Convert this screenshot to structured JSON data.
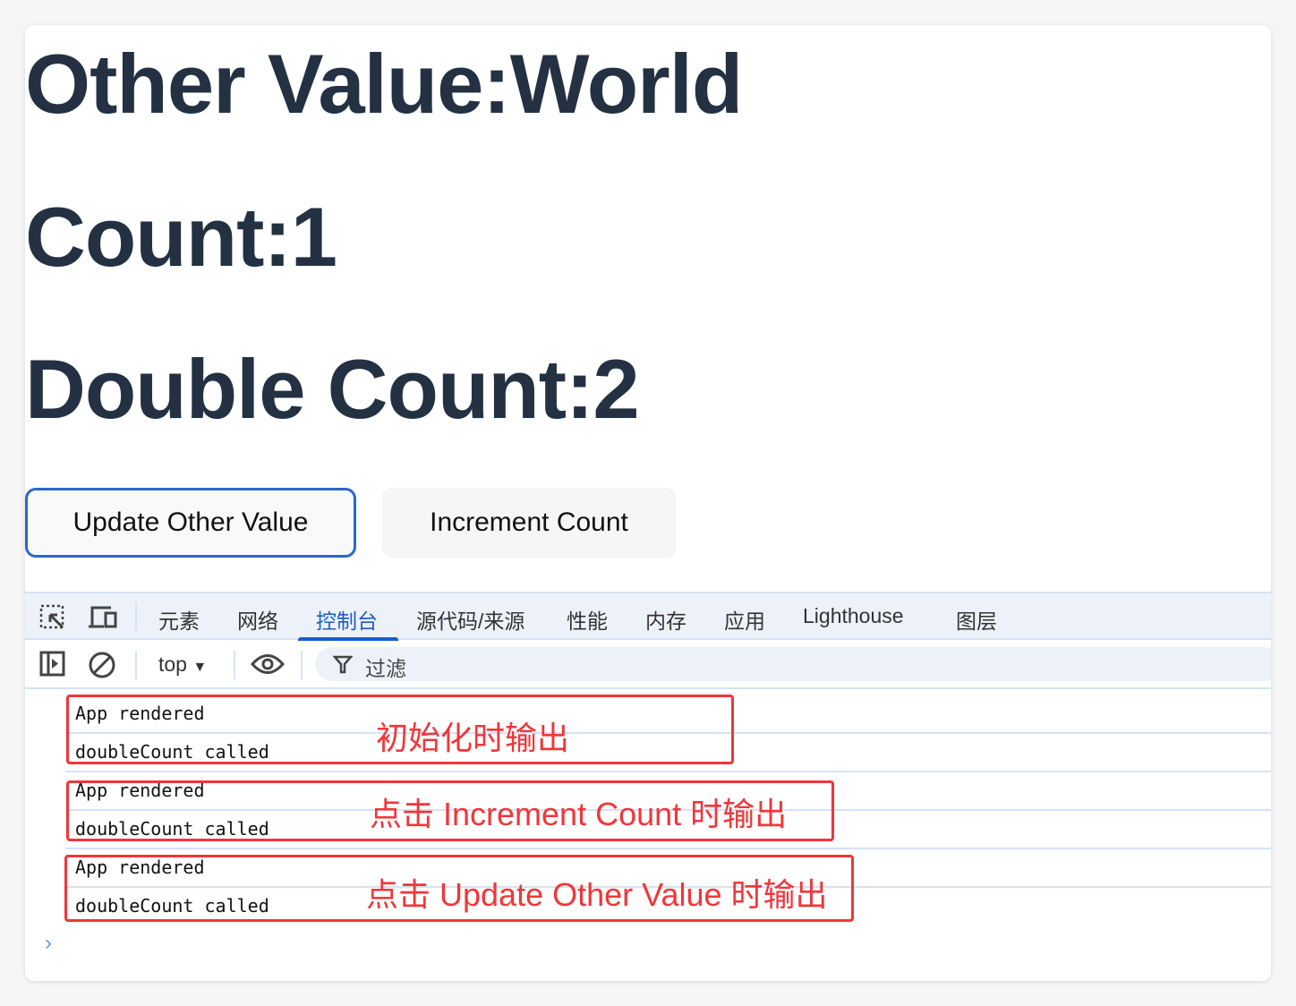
{
  "page": {
    "headings": [
      "Other Value:World",
      "Count:1",
      "Double Count:2"
    ],
    "buttons": {
      "update": "Update Other Value",
      "increment": "Increment Count"
    }
  },
  "devtools": {
    "tabs": [
      "元素",
      "网络",
      "控制台",
      "源代码/来源",
      "性能",
      "内存",
      "应用",
      "Lighthouse",
      "图层"
    ],
    "active_tab": "控制台",
    "context": "top",
    "filter_placeholder": "过滤",
    "messages": [
      "App rendered",
      "doubleCount called",
      "App rendered",
      "doubleCount called",
      "App rendered",
      "doubleCount called"
    ],
    "accent": "#1a5bd0"
  },
  "annotations": [
    "初始化时输出",
    "点击 Increment Count  时输出",
    "点击 Update Other Value  时输出"
  ],
  "annotation_color": "#f0363a"
}
